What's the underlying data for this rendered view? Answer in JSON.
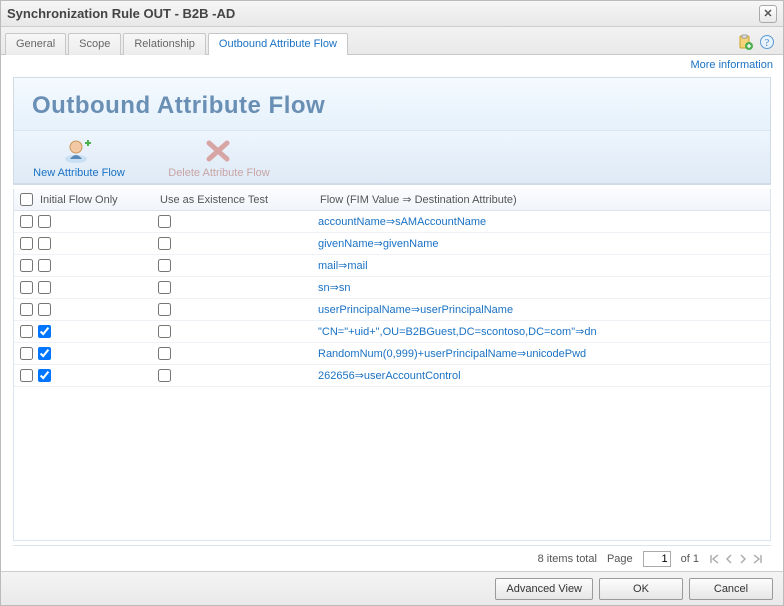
{
  "window": {
    "title": "Synchronization Rule OUT - B2B -AD",
    "close_glyph": "✕"
  },
  "tabs": {
    "items": [
      {
        "label": "General",
        "active": false
      },
      {
        "label": "Scope",
        "active": false
      },
      {
        "label": "Relationship",
        "active": false
      },
      {
        "label": "Outbound Attribute Flow",
        "active": true
      }
    ]
  },
  "links": {
    "more_info": "More information"
  },
  "panel": {
    "title": "Outbound Attribute Flow"
  },
  "toolbar": {
    "new_label": "New Attribute Flow",
    "delete_label": "Delete Attribute Flow"
  },
  "grid": {
    "headers": {
      "initial": "Initial Flow Only",
      "existence": "Use as Existence Test",
      "flow": "Flow (FIM Value ⇒ Destination Attribute)"
    },
    "rows": [
      {
        "sel": false,
        "init": false,
        "exist": false,
        "flow": "accountName⇒sAMAccountName"
      },
      {
        "sel": false,
        "init": false,
        "exist": false,
        "flow": "givenName⇒givenName"
      },
      {
        "sel": false,
        "init": false,
        "exist": false,
        "flow": "mail⇒mail"
      },
      {
        "sel": false,
        "init": false,
        "exist": false,
        "flow": "sn⇒sn"
      },
      {
        "sel": false,
        "init": false,
        "exist": false,
        "flow": "userPrincipalName⇒userPrincipalName"
      },
      {
        "sel": false,
        "init": true,
        "exist": false,
        "flow": "\"CN=\"+uid+\",OU=B2BGuest,DC=scontoso,DC=com\"⇒dn"
      },
      {
        "sel": false,
        "init": true,
        "exist": false,
        "flow": "RandomNum(0,999)+userPrincipalName⇒unicodePwd"
      },
      {
        "sel": false,
        "init": true,
        "exist": false,
        "flow": "262656⇒userAccountControl"
      }
    ]
  },
  "pager": {
    "total_text": "8 items total",
    "page_label": "Page",
    "page_value": "1",
    "of_text": "of 1"
  },
  "footer": {
    "advanced": "Advanced View",
    "ok": "OK",
    "cancel": "Cancel"
  }
}
